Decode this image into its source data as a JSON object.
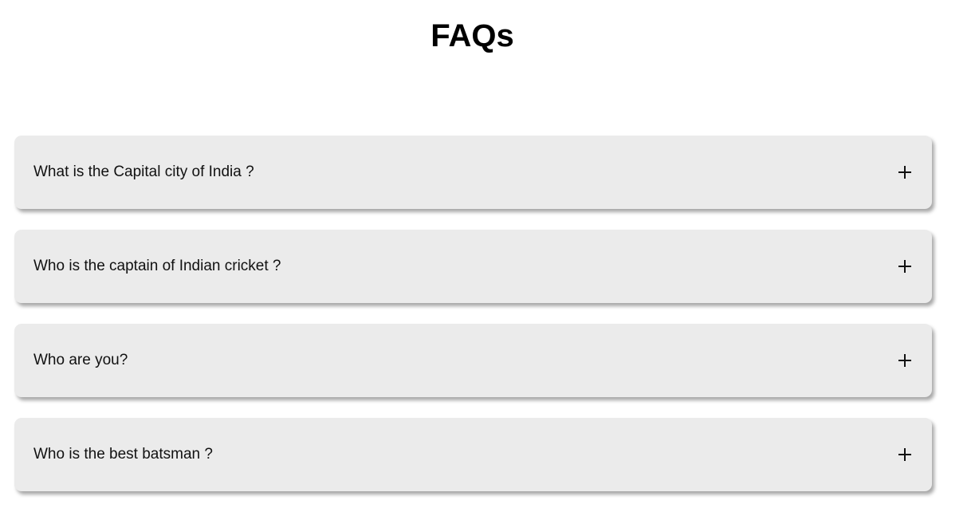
{
  "page": {
    "title": "FAQs"
  },
  "faqs": [
    {
      "question": "What is the Capital city of India ?",
      "expanded": false,
      "icon": "plus-icon"
    },
    {
      "question": "Who is the captain of Indian cricket ?",
      "expanded": false,
      "icon": "plus-icon"
    },
    {
      "question": "Who are you?",
      "expanded": false,
      "icon": "plus-icon"
    },
    {
      "question": "Who is the best batsman ?",
      "expanded": false,
      "icon": "plus-icon"
    }
  ],
  "colors": {
    "card_background": "#ebebeb",
    "text": "#111111"
  }
}
